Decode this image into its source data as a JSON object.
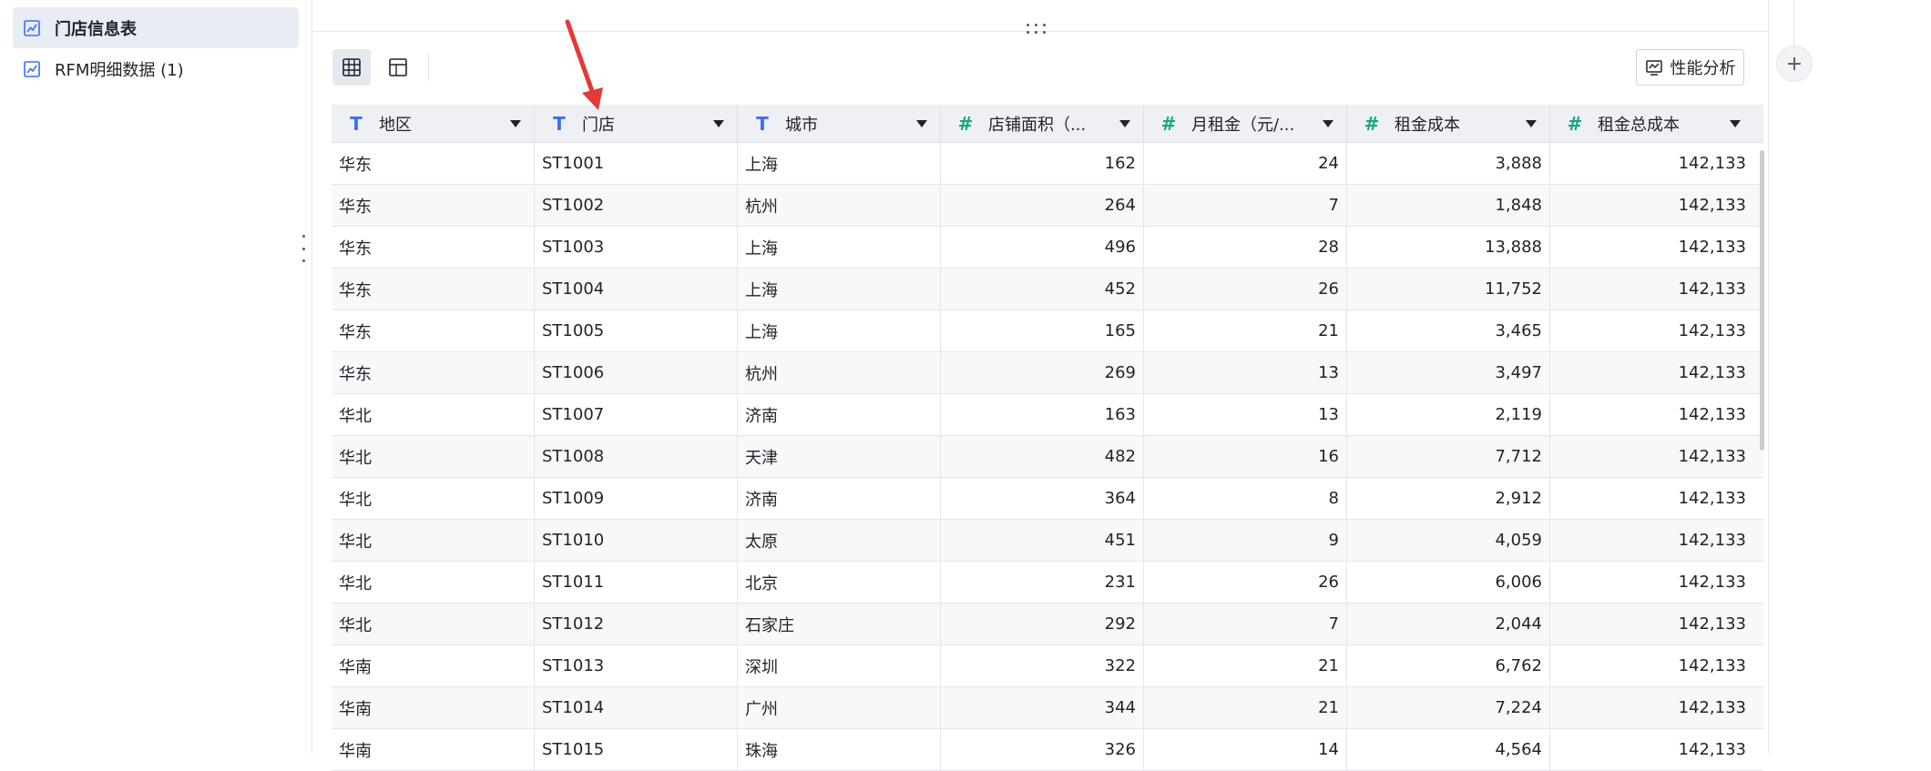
{
  "sidebar": {
    "items": [
      {
        "label": "门店信息表",
        "icon": "line-chart-icon",
        "active": true
      },
      {
        "label": "RFM明细数据 (1)",
        "icon": "line-chart-icon",
        "active": false
      }
    ]
  },
  "toolbar": {
    "views": [
      {
        "icon": "grid-view-icon",
        "active": true
      },
      {
        "icon": "layout-view-icon",
        "active": false
      }
    ],
    "perf_button_label": "性能分析",
    "add_icon": "+"
  },
  "table": {
    "columns": [
      {
        "label": "地区",
        "type": "text"
      },
      {
        "label": "门店",
        "type": "text"
      },
      {
        "label": "城市",
        "type": "text"
      },
      {
        "label": "店铺面积（...",
        "type": "number"
      },
      {
        "label": "月租金（元/...",
        "type": "number"
      },
      {
        "label": "租金成本",
        "type": "number"
      },
      {
        "label": "租金总成本",
        "type": "number"
      }
    ],
    "rows": [
      [
        "华东",
        "ST1001",
        "上海",
        "162",
        "24",
        "3,888",
        "142,133"
      ],
      [
        "华东",
        "ST1002",
        "杭州",
        "264",
        "7",
        "1,848",
        "142,133"
      ],
      [
        "华东",
        "ST1003",
        "上海",
        "496",
        "28",
        "13,888",
        "142,133"
      ],
      [
        "华东",
        "ST1004",
        "上海",
        "452",
        "26",
        "11,752",
        "142,133"
      ],
      [
        "华东",
        "ST1005",
        "上海",
        "165",
        "21",
        "3,465",
        "142,133"
      ],
      [
        "华东",
        "ST1006",
        "杭州",
        "269",
        "13",
        "3,497",
        "142,133"
      ],
      [
        "华北",
        "ST1007",
        "济南",
        "163",
        "13",
        "2,119",
        "142,133"
      ],
      [
        "华北",
        "ST1008",
        "天津",
        "482",
        "16",
        "7,712",
        "142,133"
      ],
      [
        "华北",
        "ST1009",
        "济南",
        "364",
        "8",
        "2,912",
        "142,133"
      ],
      [
        "华北",
        "ST1010",
        "太原",
        "451",
        "9",
        "4,059",
        "142,133"
      ],
      [
        "华北",
        "ST1011",
        "北京",
        "231",
        "26",
        "6,006",
        "142,133"
      ],
      [
        "华北",
        "ST1012",
        "石家庄",
        "292",
        "7",
        "2,044",
        "142,133"
      ],
      [
        "华南",
        "ST1013",
        "深圳",
        "322",
        "21",
        "6,762",
        "142,133"
      ],
      [
        "华南",
        "ST1014",
        "广州",
        "344",
        "21",
        "7,224",
        "142,133"
      ],
      [
        "华南",
        "ST1015",
        "珠海",
        "326",
        "14",
        "4,564",
        "142,133"
      ]
    ]
  },
  "colors": {
    "accent": "#3b6ef5",
    "number_icon": "#13a884",
    "annotation": "#e53935"
  }
}
